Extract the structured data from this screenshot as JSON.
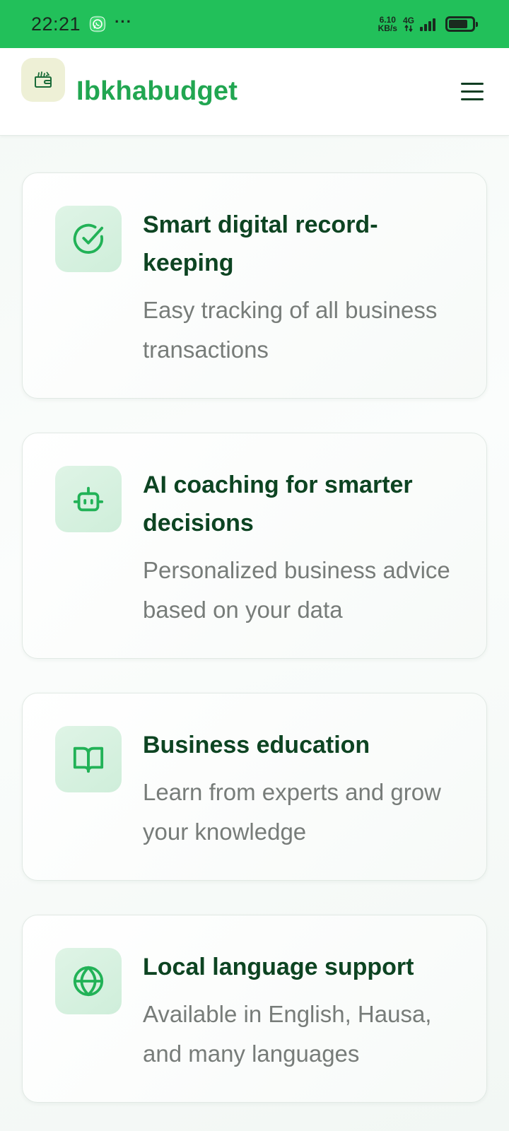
{
  "status_bar": {
    "time": "22:21",
    "dots": "···",
    "net_speed_value": "6.10",
    "net_speed_unit": "KB/s",
    "network_type": "4G",
    "icons": [
      "whatsapp-icon",
      "signal-icon",
      "battery-icon"
    ],
    "battery_level": 0.8
  },
  "header": {
    "brand": "Ibkhabudget",
    "logo_icon": "wallet-icon",
    "menu_icon": "hamburger-menu-icon"
  },
  "features": [
    {
      "icon": "check-circle-icon",
      "title": "Smart digital record-keeping",
      "description": "Easy tracking of all business transactions"
    },
    {
      "icon": "robot-icon",
      "title": "AI coaching for smarter decisions",
      "description": "Personalized business advice based on your data"
    },
    {
      "icon": "book-open-icon",
      "title": "Business education",
      "description": "Learn from experts and grow your knowledge"
    },
    {
      "icon": "globe-icon",
      "title": "Local language support",
      "description": "Available in English, Hausa, and many languages"
    }
  ],
  "colors": {
    "status_bar": "#22c05a",
    "brand_green": "#21a651",
    "title_green": "#0d4422",
    "icon_green": "#22b257",
    "icon_bg": "#dff4e6"
  }
}
